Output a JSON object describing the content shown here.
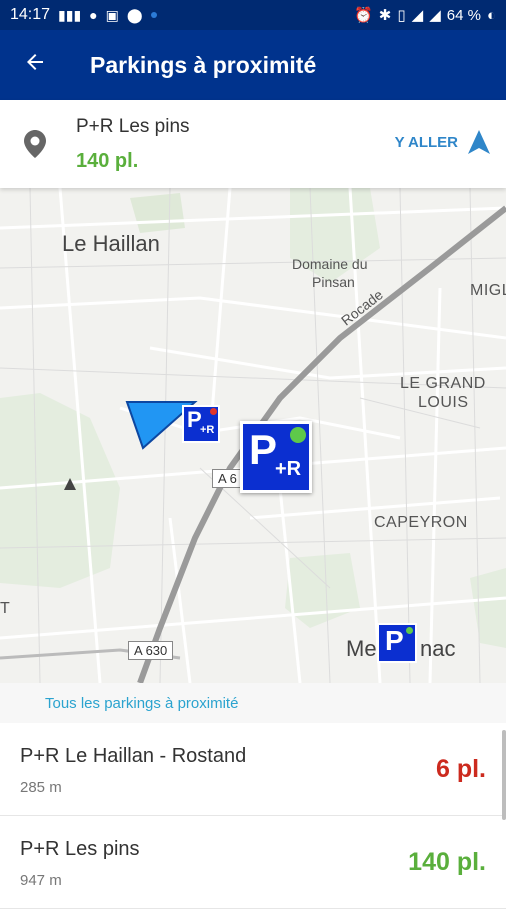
{
  "status": {
    "time": "14:17",
    "battery": "64 %"
  },
  "appbar": {
    "title": "Parkings à proximité"
  },
  "selected": {
    "name": "P+R Les pins",
    "places": "140 pl.",
    "goto_label": "Y ALLER"
  },
  "map": {
    "labels": {
      "le_haillan": "Le Haillan",
      "domaine_du": "Domaine du",
      "pinsan": "Pinsan",
      "rocade": "Rocade",
      "migl": "MIGL",
      "le_grand": "LE GRAND",
      "louis": "LOUIS",
      "capeyron": "CAPEYRON",
      "t_left": "T",
      "me": "Me",
      "nac": "nac",
      "a6": "A 6",
      "a630": "A 630"
    },
    "markers": {
      "pr_text": "P",
      "pr_suffix": "+R",
      "p_text": "P"
    }
  },
  "section_label": "Tous les parkings à proximité",
  "parkings": [
    {
      "name": "P+R Le Haillan - Rostand",
      "distance": "285 m",
      "places": "6 pl.",
      "color": "#cc2a1e"
    },
    {
      "name": "P+R Les pins",
      "distance": "947 m",
      "places": "140 pl.",
      "color": "#5aaf3c"
    }
  ]
}
